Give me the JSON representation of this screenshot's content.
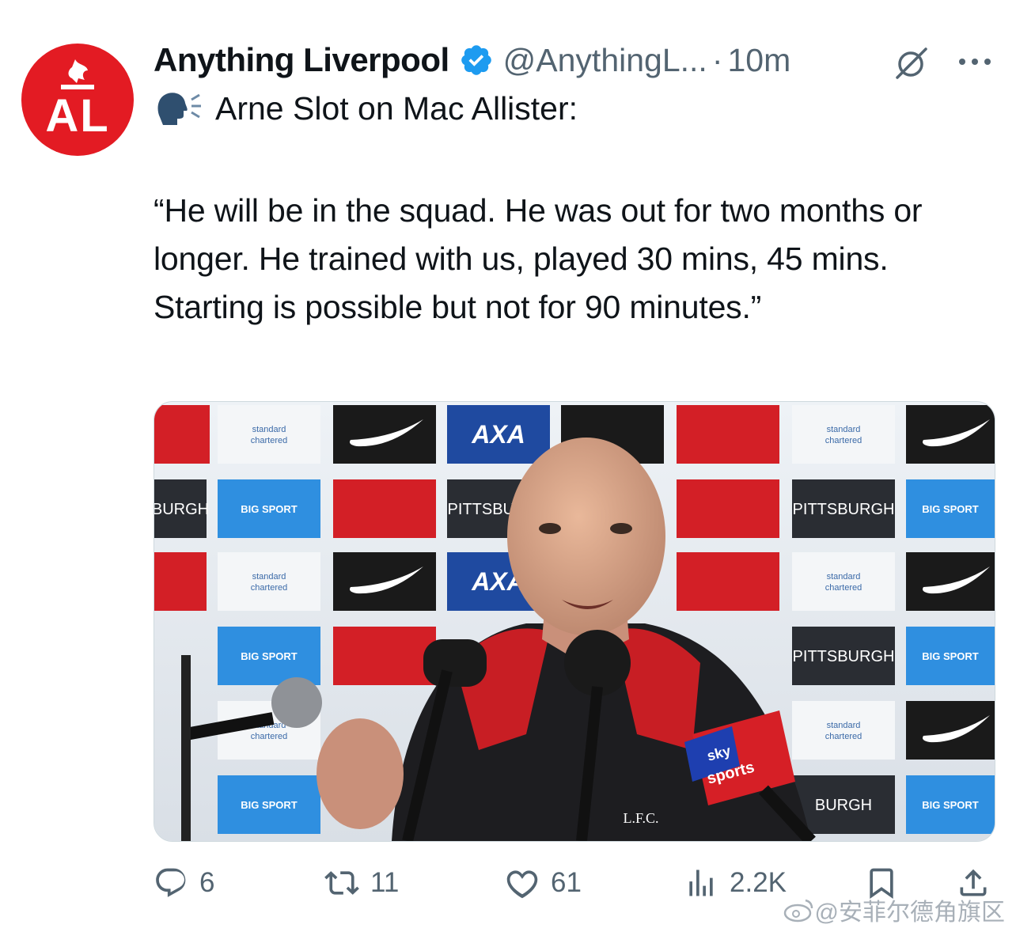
{
  "tweet": {
    "author_name": "Anything Liverpool",
    "author_handle": "@AnythingL...",
    "separator": "·",
    "time": "10m",
    "avatar_monogram": "AL",
    "intro": "Arne Slot on Mac Allister:",
    "quote": "“He will be in the squad. He was out for two months or longer. He trained with us, played 30 mins, 45 mins. Starting is possible but not for 90 minutes.”"
  },
  "media": {
    "board_texts": {
      "axa": "AXA",
      "pittsburgh": "PITTSBURGH",
      "burgh": "BURGH",
      "big_sport": "BIG SPORT",
      "standard_chartered_1": "standard",
      "standard_chartered_2": "chartered",
      "sky_1": "sky",
      "sky_2": "sports",
      "lfc": "L.F.C."
    }
  },
  "actions": {
    "reply_count": "6",
    "retweet_count": "11",
    "like_count": "61",
    "views_count": "2.2K"
  },
  "watermark": "@安菲尔德角旗区",
  "colors": {
    "liverpool_red": "#e31b23",
    "verified_blue": "#1d9bf0",
    "muted_text": "#536471"
  },
  "icons": [
    "verified-icon",
    "grok-icon",
    "more-icon",
    "speaking-head-icon",
    "reply-icon",
    "retweet-icon",
    "like-icon",
    "views-icon",
    "bookmark-icon",
    "share-icon"
  ]
}
